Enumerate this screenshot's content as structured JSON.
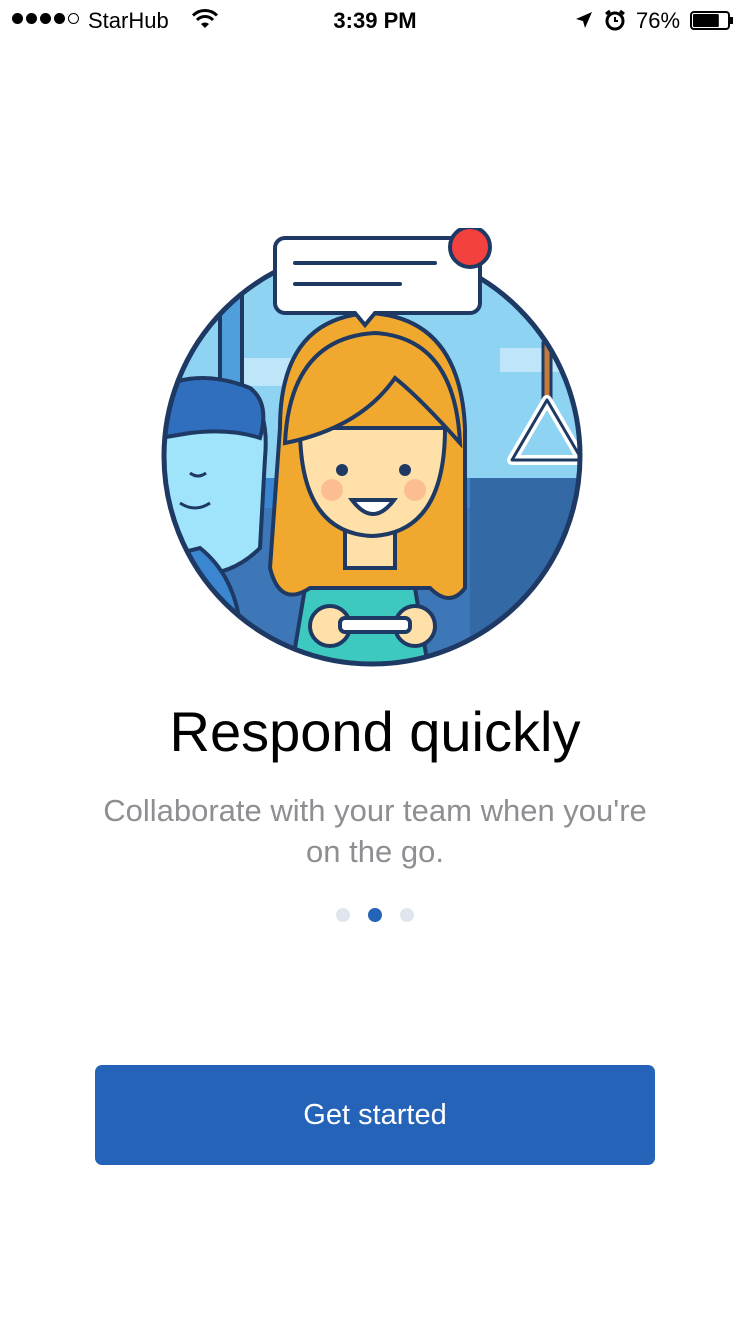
{
  "status_bar": {
    "carrier": "StarHub",
    "time": "3:39 PM",
    "battery": "76%",
    "battery_level": 0.76,
    "signal_bars": 4,
    "signal_max": 5,
    "icons": [
      "wifi-icon",
      "location-arrow-icon",
      "alarm-clock-icon",
      "battery-icon"
    ]
  },
  "onboarding": {
    "title": "Respond quickly",
    "subtitle": "Collaborate with your team when you're on the go.",
    "page_count": 3,
    "current_page": 2,
    "illustration": "woman-on-train-with-phone-illustration"
  },
  "actions": {
    "get_started_label": "Get started"
  },
  "colors": {
    "accent": "#2463B8",
    "notification": "#F2413E",
    "hair": "#F0A82F",
    "outline": "#1E3A64"
  }
}
